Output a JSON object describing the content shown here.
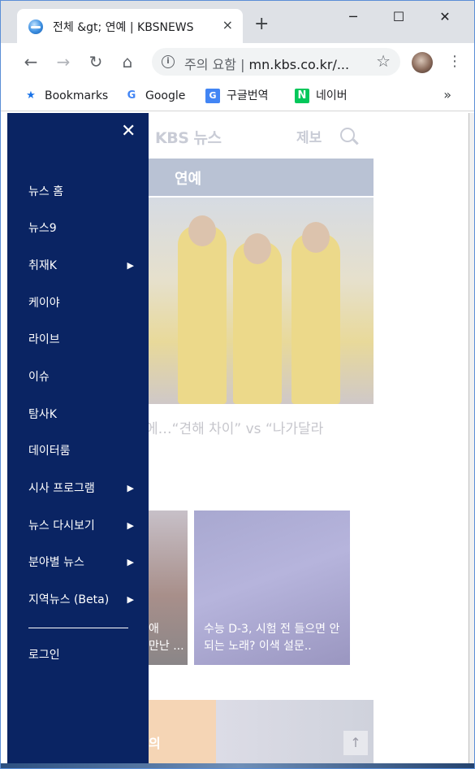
{
  "browser": {
    "tab": {
      "title": "전체 &gt; 연예 | KBSNEWS",
      "close_icon": "×",
      "new_tab_icon": "+"
    },
    "window_controls": {
      "minimize": "─",
      "maximize": "☐",
      "close": "✕"
    },
    "toolbar": {
      "back_icon": "←",
      "forward_icon": "→",
      "reload_icon": "↻",
      "home_icon": "⌂",
      "security_label": "주의 요함",
      "separator": "|",
      "url": "mn.kbs.co.kr/...",
      "bookmark_star_icon": "☆",
      "menu_icon": "⋮"
    },
    "bookmarks_bar": {
      "items": [
        {
          "label": "Bookmarks",
          "icon": "star-icon",
          "glyph": "★",
          "color": "#1a73e8"
        },
        {
          "label": "Google",
          "icon": "google-icon",
          "glyph": "G",
          "color": "#4285f4"
        },
        {
          "label": "구글번역",
          "icon": "translate-icon",
          "glyph": "G",
          "color": "#4285f4"
        },
        {
          "label": "네이버",
          "icon": "naver-icon",
          "glyph": "N",
          "color": "#03c75a"
        }
      ],
      "more_icon": "»"
    }
  },
  "page": {
    "header": {
      "logo": "KBS 뉴스",
      "report_link": "제보"
    },
    "section_title": "연예",
    "hero_caption": "에…“견해 차이” vs “나가달라",
    "cards": [
      {
        "caption": "애\n만난 ..."
      },
      {
        "caption": "수능 D-3, 시험 전 들으면 안 되는 노래? 이색 설문.."
      }
    ],
    "bottom_strip_text": "의",
    "scroll_top_icon": "↑"
  },
  "side_menu": {
    "close_icon": "✕",
    "items": [
      {
        "label": "뉴스 홈",
        "has_submenu": false
      },
      {
        "label": "뉴스9",
        "has_submenu": false
      },
      {
        "label": "취재K",
        "has_submenu": true
      },
      {
        "label": "케이야",
        "has_submenu": false
      },
      {
        "label": "라이브",
        "has_submenu": false
      },
      {
        "label": "이슈",
        "has_submenu": false
      },
      {
        "label": "탐사K",
        "has_submenu": false
      },
      {
        "label": "데이터룸",
        "has_submenu": false
      },
      {
        "label": "시사 프로그램",
        "has_submenu": true
      },
      {
        "label": "뉴스 다시보기",
        "has_submenu": true
      },
      {
        "label": "분야별 뉴스",
        "has_submenu": true
      },
      {
        "label": "지역뉴스 (Beta)",
        "has_submenu": true
      }
    ],
    "submenu_arrow": "▶",
    "login_label": "로그인",
    "background_color": "#0a2463"
  }
}
